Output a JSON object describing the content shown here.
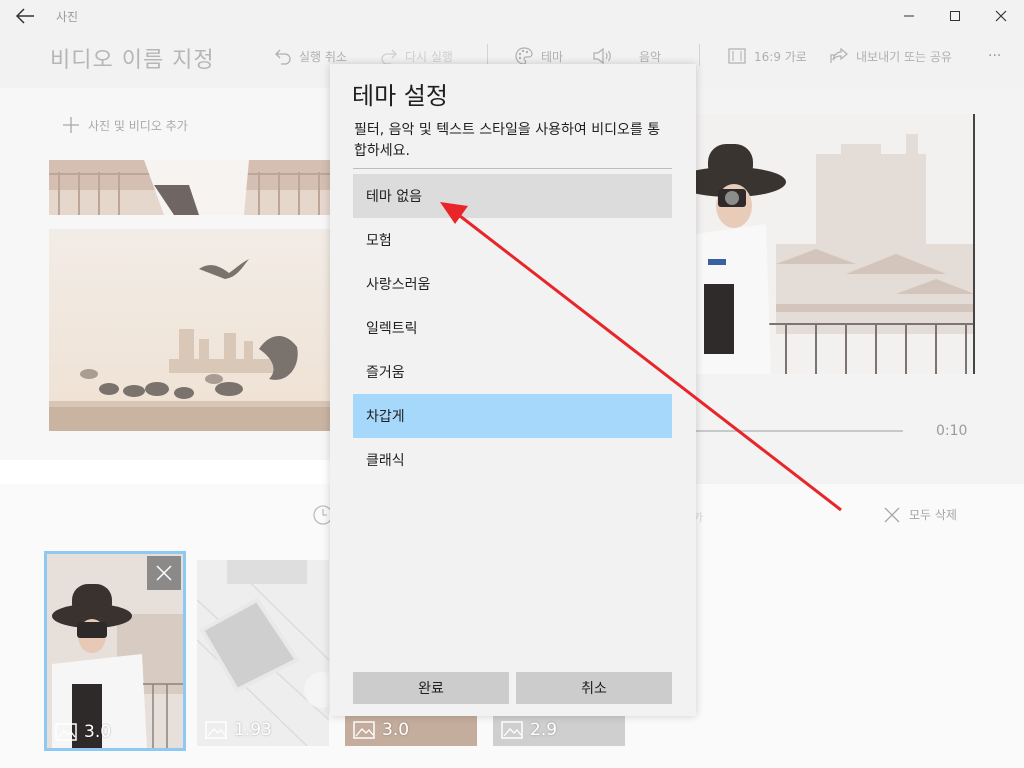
{
  "app": {
    "title": "사진"
  },
  "toolbar": {
    "video_title": "비디오 이름 지정",
    "undo": "실행 취소",
    "redo": "다시 실행",
    "theme": "테마",
    "music": "음악",
    "aspect": "16:9 가로",
    "export": "내보내기 또는 공유",
    "more": "···"
  },
  "library": {
    "add_label": "사진 및 비디오 추가"
  },
  "preview": {
    "time": "0:10"
  },
  "storyboard": {
    "faint_text": "카",
    "delete_all": "모두 삭제",
    "cards": [
      {
        "duration": "3.0",
        "selected": true
      },
      {
        "duration": "1.93",
        "selected": false
      },
      {
        "duration": "3.0",
        "selected": false
      },
      {
        "duration": "2.9",
        "selected": false
      }
    ]
  },
  "theme_dialog": {
    "title": "테마 설정",
    "description": "필터, 음악 및 텍스트 스타일을 사용하여 비디오를 통합하세요.",
    "themes": [
      "테마 없음",
      "모험",
      "사랑스러움",
      "일렉트릭",
      "즐거움",
      "차갑게",
      "클래식"
    ],
    "hovered_theme": "테마 없음",
    "selected_theme": "차갑게",
    "done_label": "완료",
    "cancel_label": "취소"
  },
  "colors": {
    "accent_selected": "#a6d8fc",
    "card_outline": "#8ec9f4",
    "annotation_arrow": "#e8262a"
  }
}
